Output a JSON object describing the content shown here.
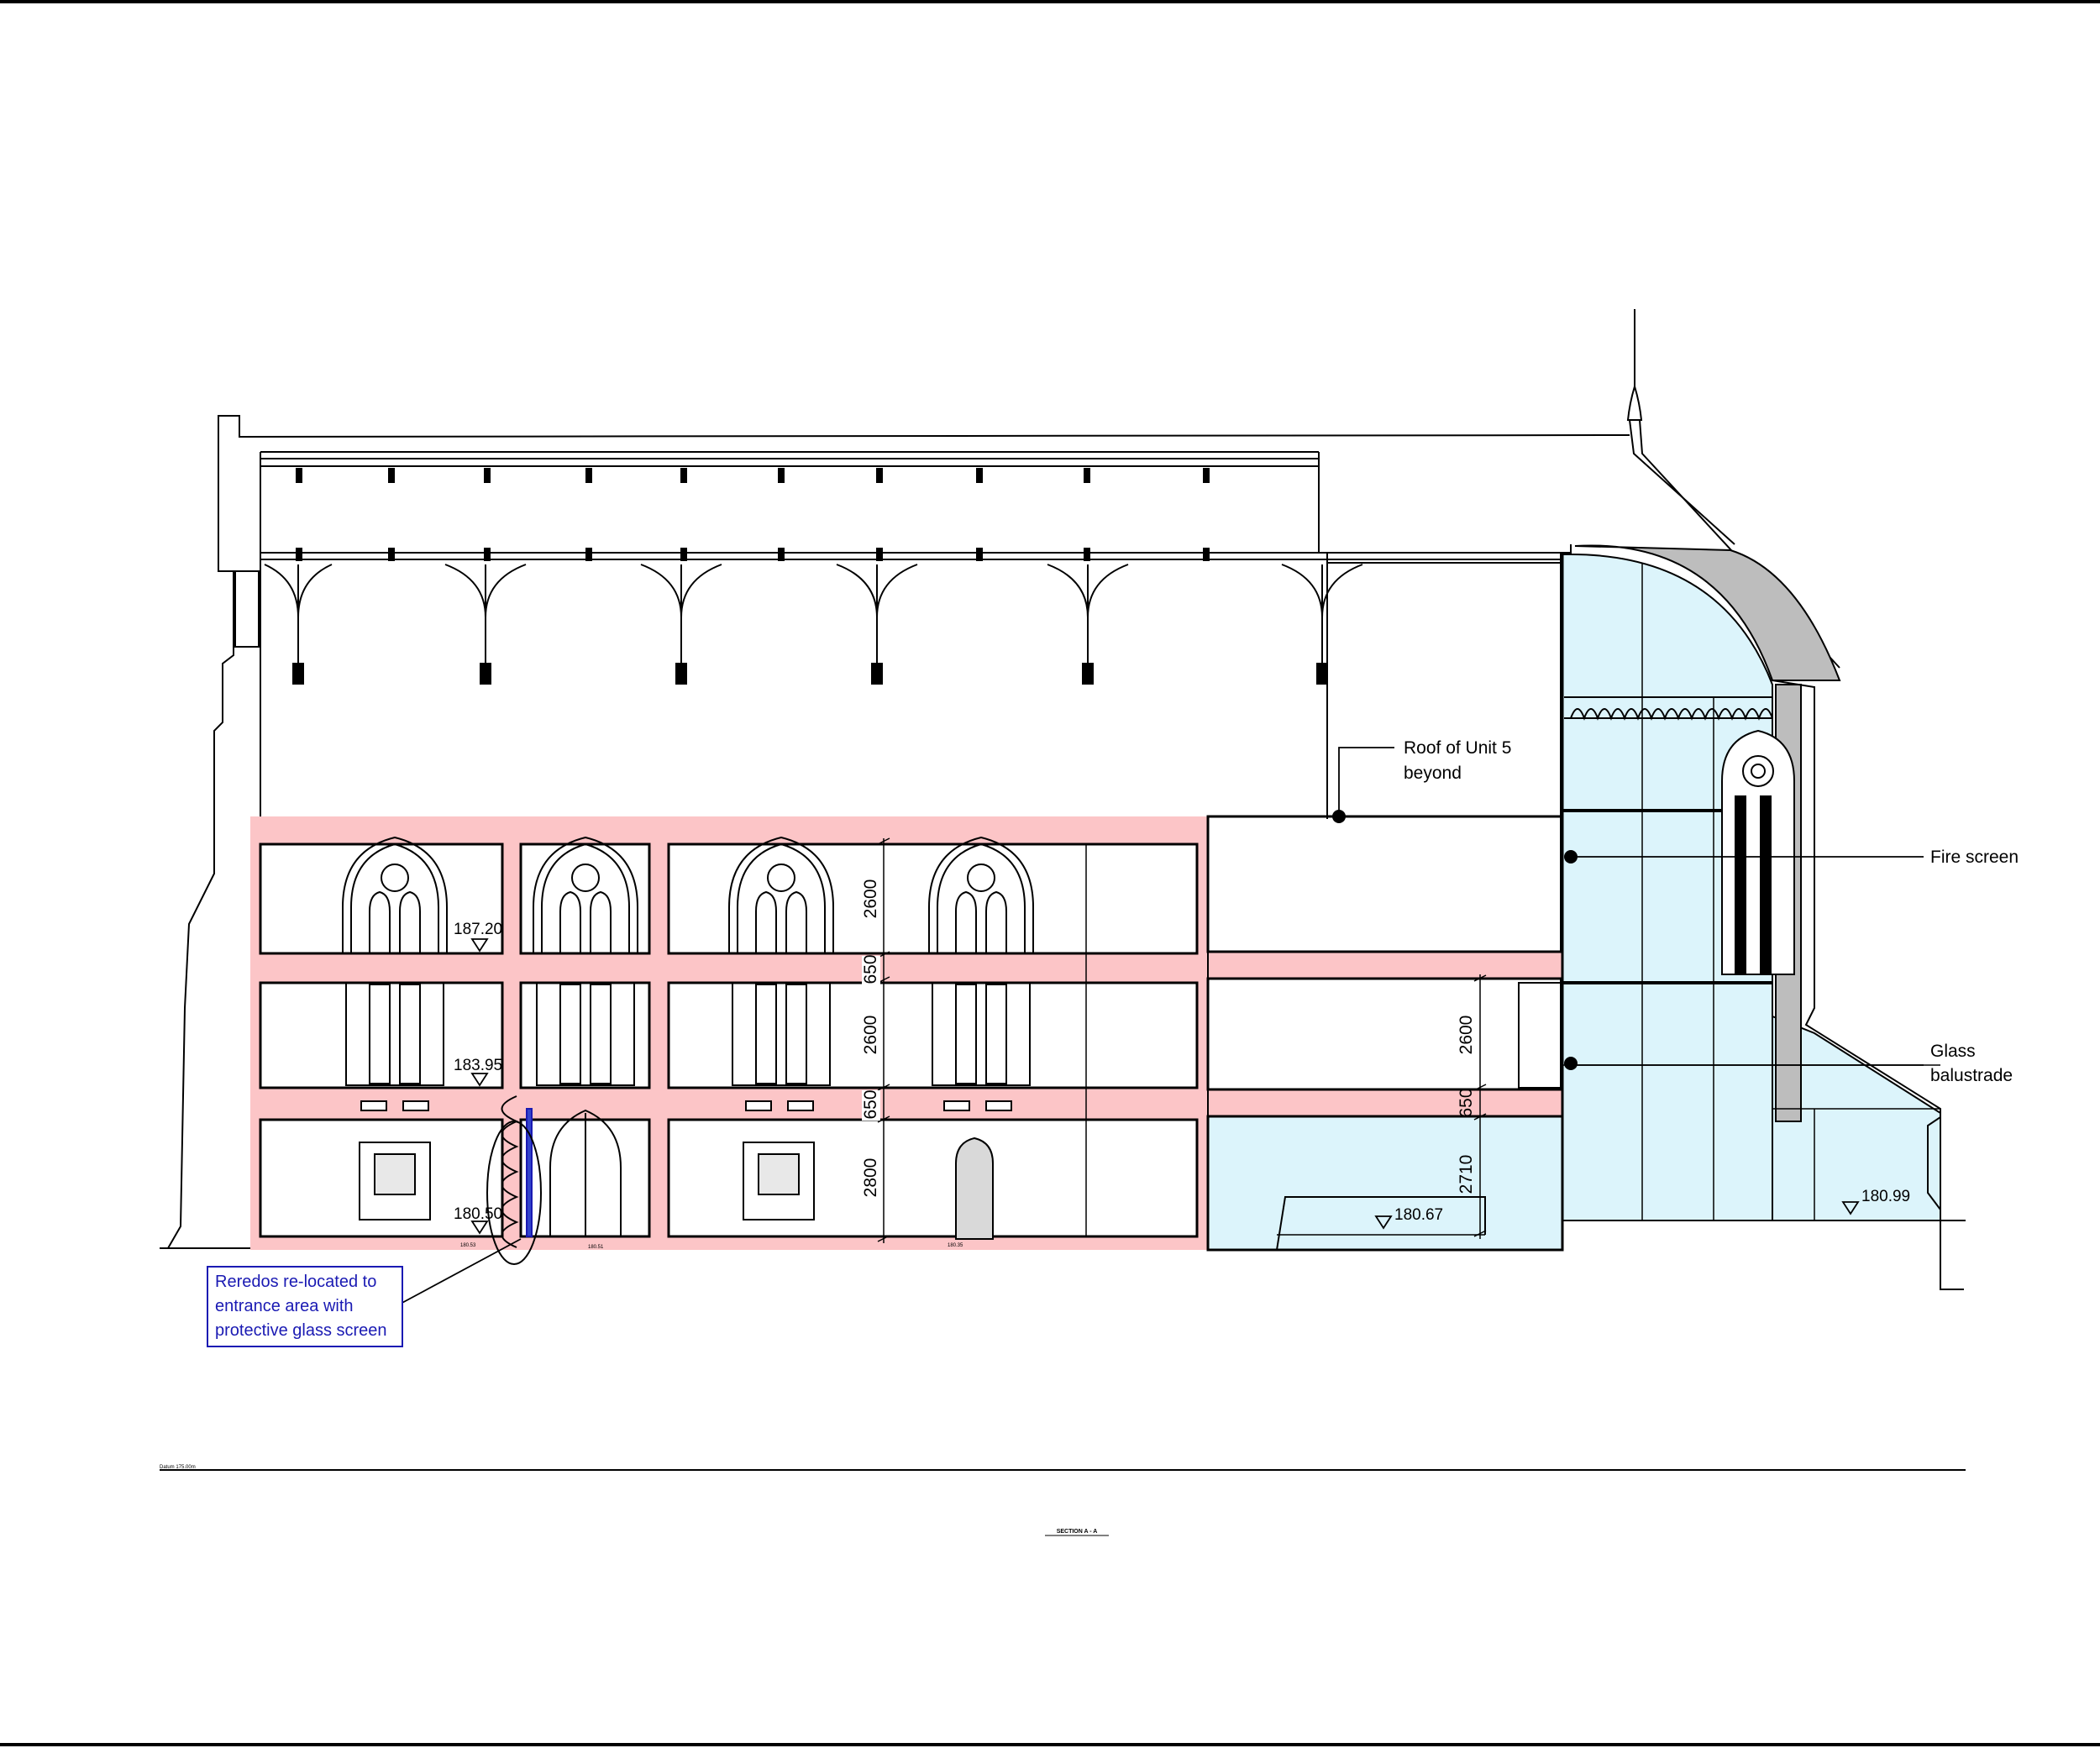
{
  "drawing": {
    "datum_label": "Datum 175.00m",
    "section_title": "SECTION A - A"
  },
  "annotations": {
    "roof_unit5": [
      "Roof of Unit 5",
      "beyond"
    ],
    "fire_screen": "Fire screen",
    "glass_balustrade": [
      "Glass",
      "balustrade"
    ],
    "reredos_note": [
      "Reredos re-located to",
      "entrance area with",
      "protective glass screen"
    ]
  },
  "levels": {
    "l1": "187.20",
    "l2": "183.95",
    "l3": "180.50",
    "l4": "180.67",
    "l5": "180.99",
    "small_a": "180.53",
    "small_b": "180.51",
    "small_c": "180.35"
  },
  "dimensions": {
    "d1": "2600",
    "d2": "650",
    "d3": "2600",
    "d4": "650",
    "d5": "2800",
    "d6": "2600",
    "d7": "650",
    "d8": "2710"
  },
  "colors": {
    "floor_slab": "#fcc5c7",
    "glazing": "#dcf4fb",
    "stone_grey": "#bdbdbd",
    "note_blue": "#1a1ab3"
  }
}
